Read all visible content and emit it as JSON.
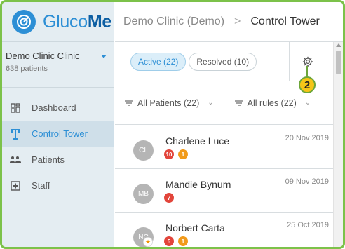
{
  "brand": {
    "name_light": "Gluco",
    "name_bold": "Me",
    "color": "#2d8fd5"
  },
  "clinic": {
    "name": "Demo Clinic Clinic",
    "patients": "638 patients"
  },
  "nav": [
    {
      "label": "Dashboard",
      "icon": "dashboard-icon"
    },
    {
      "label": "Control Tower",
      "icon": "tower-icon"
    },
    {
      "label": "Patients",
      "icon": "patients-icon"
    },
    {
      "label": "Staff",
      "icon": "staff-icon"
    }
  ],
  "breadcrumb": {
    "parent": "Demo Clinic (Demo)",
    "separator": ">",
    "current": "Control Tower"
  },
  "tabs": {
    "active": "Active (22)",
    "resolved": "Resolved (10)"
  },
  "callout": {
    "number": "2"
  },
  "filters": {
    "patients": "All Patients (22)",
    "rules": "All rules (22)"
  },
  "patients": [
    {
      "initials": "CL",
      "name": "Charlene Luce",
      "date": "20 Nov 2019",
      "red": "10",
      "orange": "1",
      "star": false
    },
    {
      "initials": "MB",
      "name": "Mandie Bynum",
      "date": "09 Nov 2019",
      "red": "7",
      "orange": "",
      "star": false
    },
    {
      "initials": "NC",
      "name": "Norbert Carta",
      "date": "25 Oct 2019",
      "red": "5",
      "orange": "1",
      "star": true
    }
  ]
}
